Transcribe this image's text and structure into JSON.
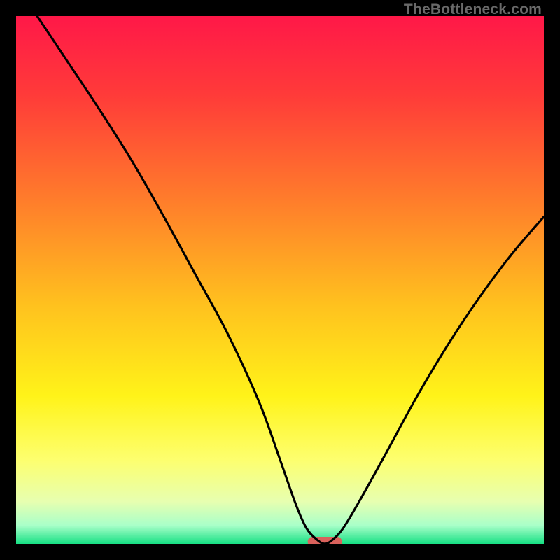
{
  "watermark": "TheBottleneck.com",
  "chart_data": {
    "type": "line",
    "title": "",
    "xlabel": "",
    "ylabel": "",
    "xlim": [
      0,
      100
    ],
    "ylim": [
      0,
      100
    ],
    "grid": false,
    "series": [
      {
        "name": "bottleneck-curve",
        "x": [
          4,
          10,
          16,
          22,
          28,
          34,
          40,
          46,
          50,
          53,
          55,
          57,
          58.5,
          60,
          62,
          65,
          70,
          76,
          82,
          88,
          94,
          100
        ],
        "values": [
          100,
          91,
          82,
          72.5,
          62,
          51,
          40,
          27,
          16,
          7.5,
          3,
          0.8,
          0,
          0.8,
          3,
          8,
          17,
          28,
          38,
          47,
          55,
          62
        ]
      }
    ],
    "background_gradient": {
      "stops": [
        {
          "pos": 0.0,
          "color": "#ff1848"
        },
        {
          "pos": 0.15,
          "color": "#ff3b39"
        },
        {
          "pos": 0.35,
          "color": "#ff7d2b"
        },
        {
          "pos": 0.55,
          "color": "#ffc21e"
        },
        {
          "pos": 0.72,
          "color": "#fff319"
        },
        {
          "pos": 0.84,
          "color": "#fdff6e"
        },
        {
          "pos": 0.92,
          "color": "#e7ffb0"
        },
        {
          "pos": 0.965,
          "color": "#a9ffc9"
        },
        {
          "pos": 1.0,
          "color": "#17e084"
        }
      ]
    },
    "marker": {
      "x_center": 58.5,
      "y": 0,
      "width_pct": 6.5,
      "color": "#d9625c"
    }
  }
}
